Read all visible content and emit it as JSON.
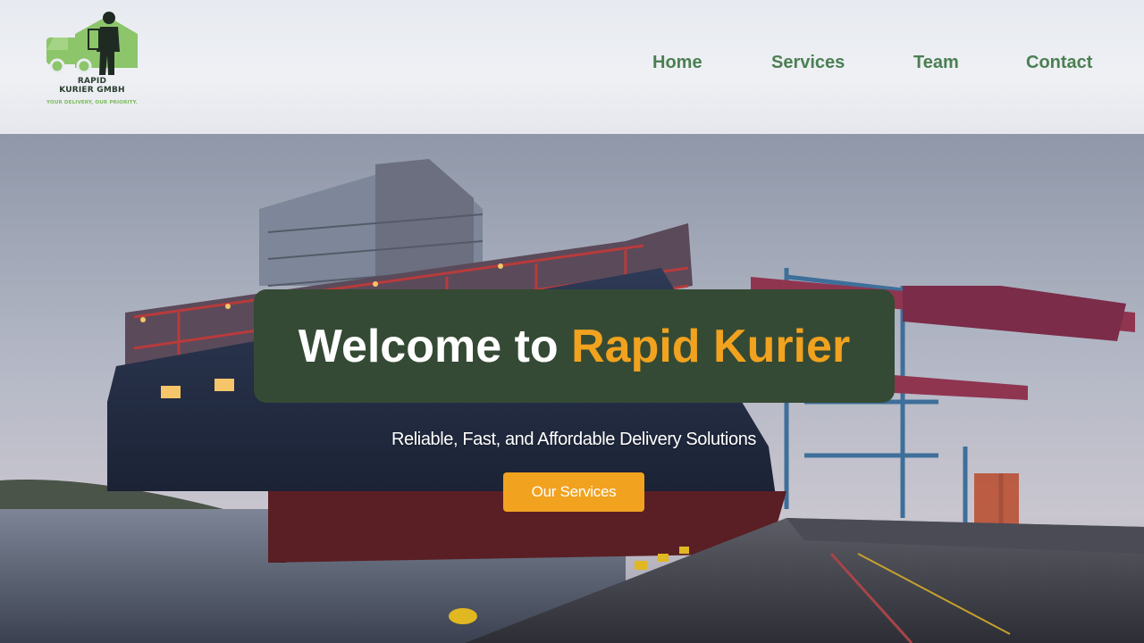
{
  "header": {
    "logo": {
      "name_line1": "RAPID",
      "name_line2": "KURIER GMBH",
      "tagline": "YOUR DELIVERY, OUR PRIORITY.",
      "icon": "courier-truck-person-icon"
    },
    "nav": [
      {
        "label": "Home"
      },
      {
        "label": "Services"
      },
      {
        "label": "Team"
      },
      {
        "label": "Contact"
      }
    ]
  },
  "hero": {
    "background": "container-ship-at-port-image",
    "title_prefix": "Welcome to",
    "title_brand": "Rapid Kurier",
    "subtitle": "Reliable, Fast, and Affordable Delivery Solutions",
    "cta_label": "Our Services"
  },
  "colors": {
    "nav_text": "#4b7f52",
    "title_box": "#354a34",
    "accent": "#f1a21f",
    "logo_green": "#7cbc5c"
  }
}
